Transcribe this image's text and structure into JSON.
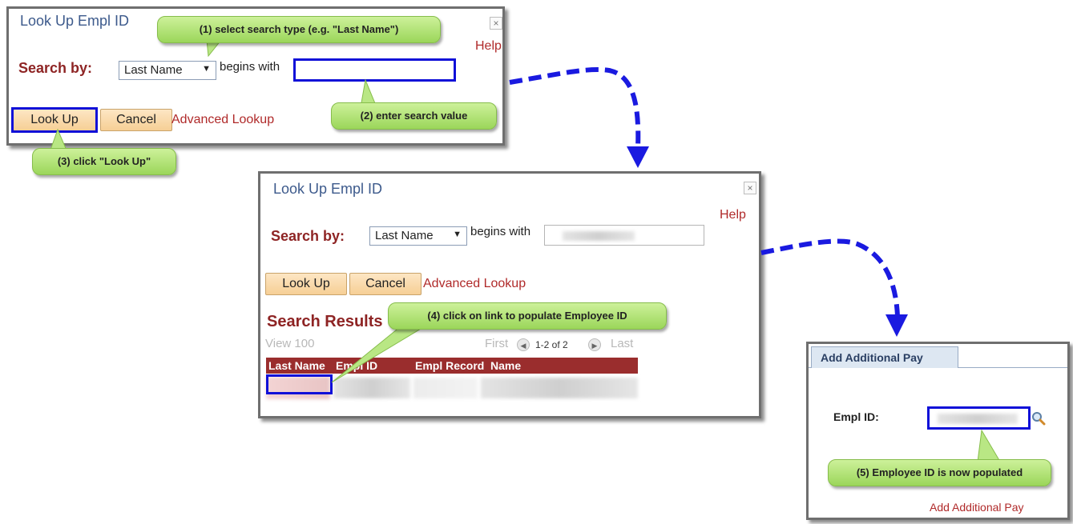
{
  "dialog1": {
    "title": "Look Up Empl ID",
    "close": "×",
    "help": "Help",
    "search_by": "Search by:",
    "select_value": "Last Name",
    "select_arrow": "▼",
    "begins_with": "begins with",
    "input_value": "",
    "lookup_label": "Look Up",
    "cancel_label": "Cancel",
    "advanced_label": "Advanced Lookup"
  },
  "dialog2": {
    "title": "Look Up Empl ID",
    "close": "×",
    "help": "Help",
    "search_by": "Search by:",
    "select_value": "Last Name",
    "select_arrow": "▼",
    "begins_with": "begins with",
    "lookup_label": "Look Up",
    "cancel_label": "Cancel",
    "advanced_label": "Advanced Lookup",
    "results_title": "Search Results",
    "view_all": "View 100",
    "first": "First",
    "page_info": "1-2 of 2",
    "last": "Last",
    "prev_icon": "◀",
    "next_icon": "▶",
    "columns": [
      "Last Name",
      "Empl ID",
      "Empl Record",
      "Name"
    ]
  },
  "panel3": {
    "tab_label": "Add Additional Pay",
    "empl_id_label": "Empl ID:",
    "search_icon": "magnifier-icon",
    "add_link": "Add Additional Pay"
  },
  "callouts": {
    "c1": "(1) select search type (e.g. \"Last Name\")",
    "c2": "(2) enter search value",
    "c3": "(3) click \"Look Up\"",
    "c4": "(4) click on link to populate Employee ID",
    "c5": "(5) Employee ID is now populated"
  },
  "colors": {
    "callout_green": "#a8dd6a",
    "highlight_blue": "#1010d8",
    "arrow_blue": "#1a1ae0",
    "header_red": "#9a2d2d"
  }
}
